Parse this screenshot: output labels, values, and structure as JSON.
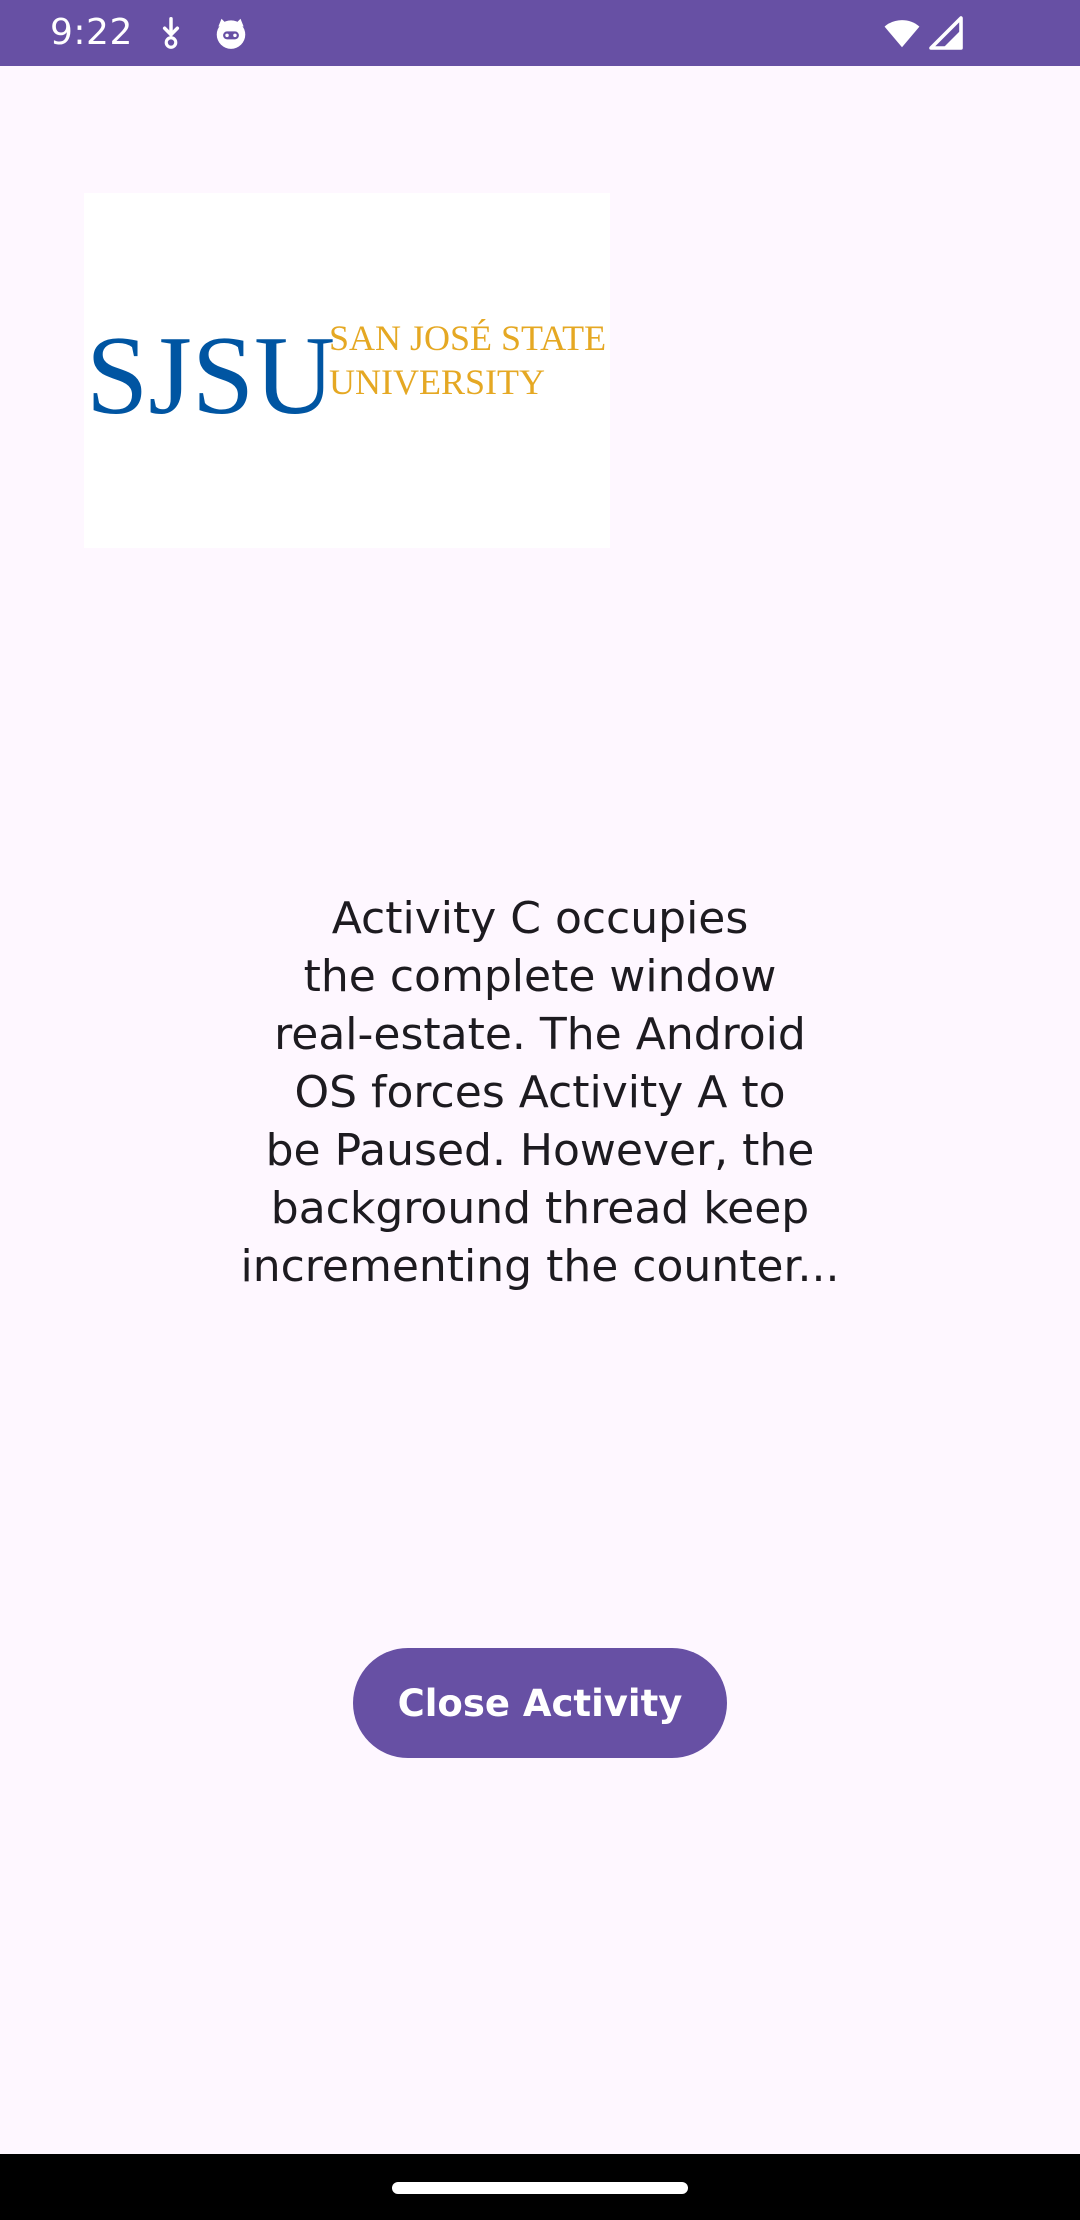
{
  "status_bar": {
    "time": "9:22",
    "icons": [
      "download-icon",
      "cat-face-icon",
      "wifi-icon",
      "cell-signal-icon"
    ],
    "color": "#6750A4"
  },
  "logo": {
    "monogram": "SJSU",
    "line1": "SAN JOSÉ STATE",
    "line2": "UNIVERSITY",
    "monogram_color": "#0055A2",
    "text_color": "#E5A823"
  },
  "message": {
    "text": "Activity C occupies\nthe complete window\nreal-estate. The Android\nOS forces Activity A to\nbe Paused. However, the\nbackground thread keep\nincrementing the counter..."
  },
  "actions": {
    "close_label": "Close Activity"
  },
  "theme": {
    "background": "#FEF7FF",
    "primary": "#6750A4",
    "on_primary": "#FFFFFF"
  }
}
